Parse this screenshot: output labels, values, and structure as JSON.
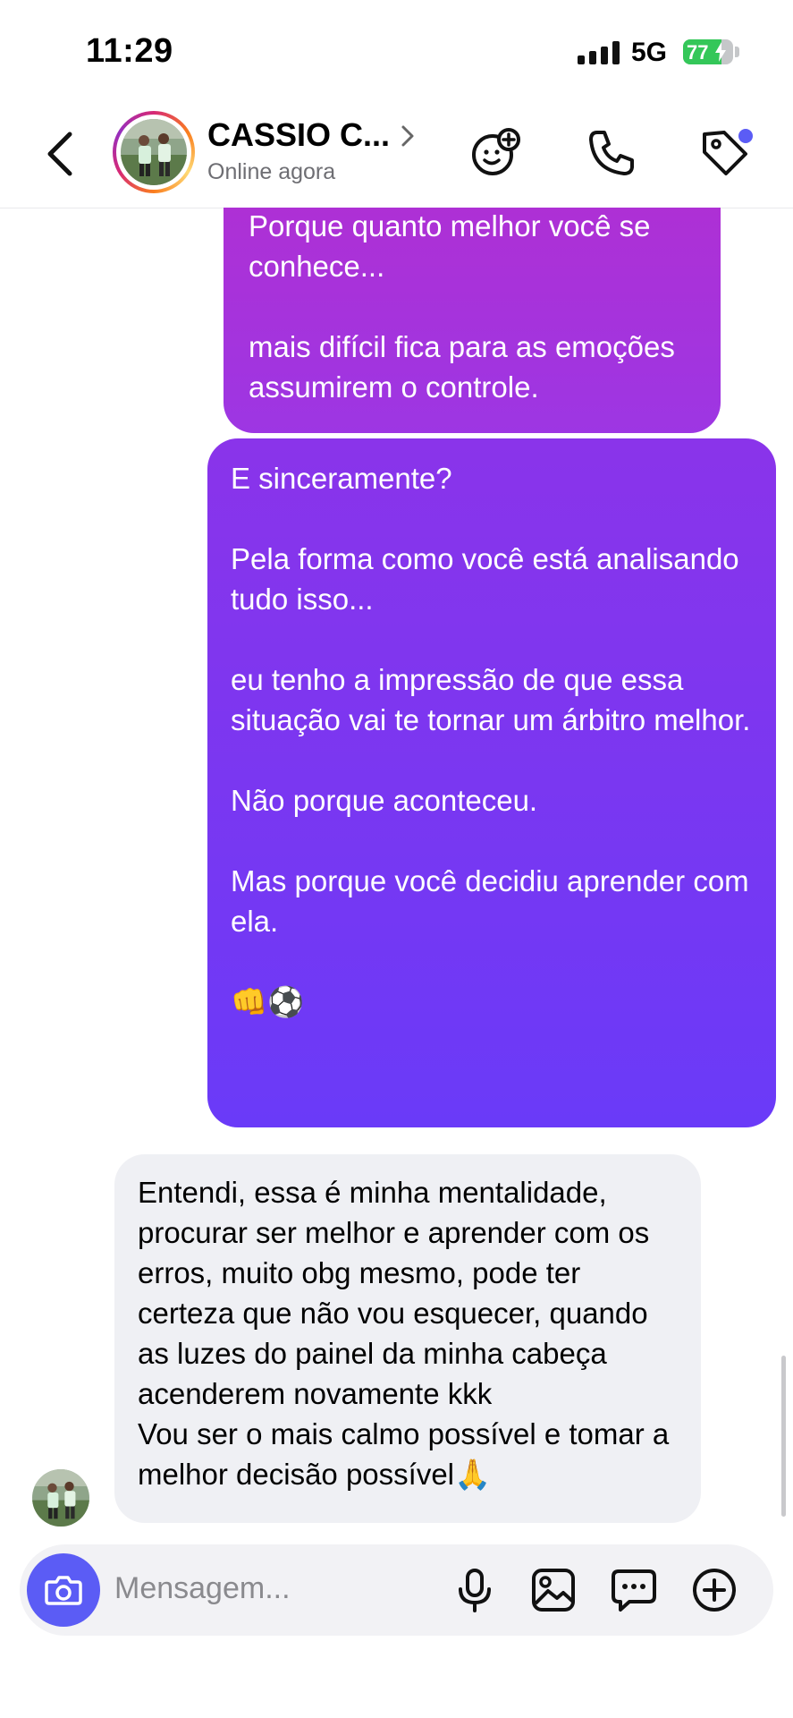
{
  "status_bar": {
    "time": "11:29",
    "network": "5G",
    "battery": "77",
    "battery_level": 0.77
  },
  "header": {
    "contact_name": "CASSIO C...",
    "presence": "Online agora"
  },
  "messages": [
    {
      "direction": "outgoing",
      "text": "Porque quanto melhor você se conhece...\n\nmais difícil fica para as emoções assumirem o controle."
    },
    {
      "direction": "outgoing",
      "text": "E sinceramente?\n\nPela forma como você está analisando tudo isso...\n\neu tenho a impressão de que essa situação vai te tornar um árbitro melhor.\n\nNão porque aconteceu.\n\nMas porque você decidiu aprender com ela.\n\n👊⚽"
    },
    {
      "direction": "incoming",
      "text": "Entendi, essa é minha mentalidade, procurar ser melhor e aprender com os erros, muito obg mesmo, pode ter certeza que não vou esquecer, quando as luzes do painel da minha cabeça acenderem novamente kkk\nVou ser o mais calmo possível e tomar a melhor decisão possível🙏"
    }
  ],
  "composer": {
    "placeholder": "Mensagem..."
  },
  "colors": {
    "accent": "#5b5cf5",
    "outgoing_top": "#b12fd2",
    "outgoing_bottom": "#6a3af8",
    "incoming": "#eff0f4"
  }
}
